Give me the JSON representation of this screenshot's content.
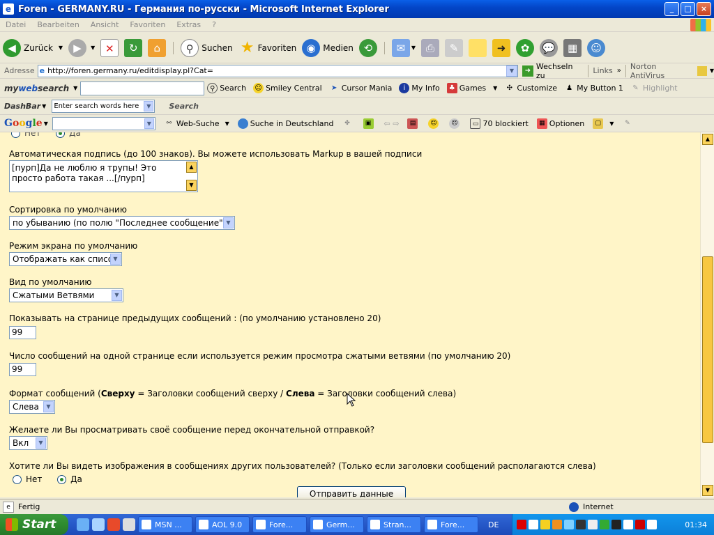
{
  "window": {
    "title": "Foren - GERMANY.RU - Германия по-русски - Microsoft Internet Explorer"
  },
  "menu": [
    "Datei",
    "Bearbeiten",
    "Ansicht",
    "Favoriten",
    "Extras",
    "?"
  ],
  "toolbar": {
    "back": "Zurück",
    "search": "Suchen",
    "favorites": "Favoriten",
    "media": "Medien"
  },
  "address": {
    "label": "Adresse",
    "url": "http://foren.germany.ru/editdisplay.pl?Cat=",
    "go": "Wechseln zu",
    "links": "Links",
    "norton": "Norton AntiVirus"
  },
  "mws": {
    "logo_a": "my",
    "logo_b": "web",
    "logo_c": "search",
    "search": "Search",
    "smiley": "Smiley Central",
    "cursor": "Cursor Mania",
    "info": "My Info",
    "games": "Games",
    "customize": "Customize",
    "button1": "My Button 1",
    "highlight": "Highlight"
  },
  "dashbar": {
    "logo": "DashBar",
    "placeholder": "Enter search words here",
    "search": "Search"
  },
  "googlebar": {
    "logo": [
      "G",
      "o",
      "o",
      "g",
      "l",
      "e"
    ],
    "web": "Web-Suche",
    "germany": "Suche in Deutschland",
    "blocked": "70 blockiert",
    "options": "Optionen"
  },
  "form": {
    "top_radio": {
      "no": "Нет",
      "yes": "Да"
    },
    "signature": {
      "label": "Автоматическая подпись (до 100 знаков). Вы можете использовать Markup в вашей подписи",
      "value": "[пурп]Да не люблю я трупы! Это просто работа такая ...[/пурп]"
    },
    "sort": {
      "label": "Сортировка по умолчанию",
      "value": "по убыванию (по полю \"Последнее сообщение\")"
    },
    "screen_mode": {
      "label": "Режим экрана по умолчанию",
      "value": "Отображать как список"
    },
    "view": {
      "label": "Вид по умолчанию",
      "value": "Сжатыми Ветвями"
    },
    "prev_count": {
      "label": "Показывать на странице предыдущих сообщений : (по умолчанию установлено 20)",
      "value": "99"
    },
    "per_page": {
      "label": "Число сообщений на одной странице если используется режим просмотра сжатыми ветвями (по умолчанию 20)",
      "value": "99"
    },
    "format": {
      "label_a": "Формат сообщений (",
      "bold_a": "Сверху",
      "label_b": " = Заголовки сообщений сверху / ",
      "bold_b": "Слева",
      "label_c": " = Заголовки сообщений слева)",
      "value": "Слева"
    },
    "preview": {
      "label": "Желаете ли Вы просматривать своё сообщение перед окончательной отправкой?",
      "value": "Вкл"
    },
    "images": {
      "label": "Хотите ли Вы видеть изображения в сообщениях других пользователей? (Только если заголовки сообщений располагаются слева)",
      "no": "Нет",
      "yes": "Да"
    },
    "submit": "Отправить данные"
  },
  "status": {
    "text": "Fertig",
    "zone": "Internet"
  },
  "taskbar": {
    "start": "Start",
    "tasks": [
      "MSN ...",
      "AOL 9.0",
      "Fore...",
      "Germ...",
      "Stran...",
      "Fore..."
    ],
    "lang": "DE",
    "clock": "01:34"
  }
}
